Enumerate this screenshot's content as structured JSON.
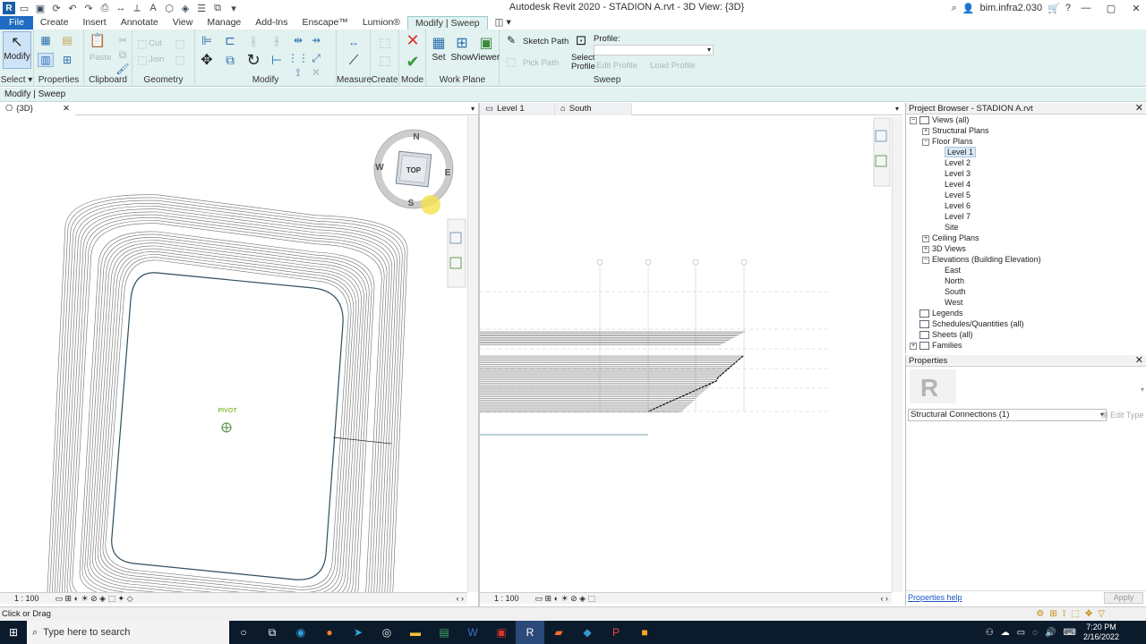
{
  "window": {
    "title": "Autodesk Revit 2020 - STADION A.rvt - 3D View: {3D}",
    "user": "bim.infra2.030"
  },
  "ribbon_tabs": [
    {
      "label": "File"
    },
    {
      "label": "Create"
    },
    {
      "label": "Insert"
    },
    {
      "label": "Annotate"
    },
    {
      "label": "View"
    },
    {
      "label": "Manage"
    },
    {
      "label": "Add-Ins"
    },
    {
      "label": "Enscape™"
    },
    {
      "label": "Lumion®"
    },
    {
      "label": "Modify | Sweep"
    }
  ],
  "ribbon": {
    "modify": "Modify",
    "select": "Select ▾",
    "properties": "Properties",
    "clipboard": "Clipboard",
    "paste": "Paste",
    "cut": "Cut",
    "join": "Join",
    "geometry": "Geometry",
    "modify_panel": "Modify",
    "measure": "Measure",
    "create": "Create",
    "mode": "Mode",
    "set": "Set",
    "show": "Show",
    "viewer": "Viewer",
    "work_plane": "Work Plane",
    "sketch_path": "Sketch Path",
    "pick_path": "Pick Path",
    "select_profile_line1": "Select",
    "select_profile_line2": "Profile",
    "profile_label": "Profile:",
    "edit_profile": "Edit Profile",
    "load_profile": "Load Profile",
    "sweep": "Sweep"
  },
  "context_bar": "Modify | Sweep",
  "view_tabs_left": [
    {
      "label": "{3D}"
    }
  ],
  "view_tabs_right": [
    {
      "label": "Level 1"
    },
    {
      "label": "South"
    }
  ],
  "view3d": {
    "pivot_label": "PIVOT",
    "viewcube_top": "TOP",
    "compass": {
      "n": "N",
      "s": "S",
      "e": "E",
      "w": "W"
    },
    "scale": "1 : 100"
  },
  "view_right": {
    "scale": "1 : 100"
  },
  "project_browser": {
    "title": "Project Browser - STADION A.rvt",
    "items": [
      {
        "label": "Views (all)",
        "indent": 0,
        "toggle": "−",
        "icon": true
      },
      {
        "label": "Structural Plans",
        "indent": 1,
        "toggle": "+"
      },
      {
        "label": "Floor Plans",
        "indent": 1,
        "toggle": "−"
      },
      {
        "label": "Level 1",
        "indent": 2,
        "selected": true
      },
      {
        "label": "Level 2",
        "indent": 2
      },
      {
        "label": "Level 3",
        "indent": 2
      },
      {
        "label": "Level 4",
        "indent": 2
      },
      {
        "label": "Level 5",
        "indent": 2
      },
      {
        "label": "Level 6",
        "indent": 2
      },
      {
        "label": "Level 7",
        "indent": 2
      },
      {
        "label": "Site",
        "indent": 2
      },
      {
        "label": "Ceiling Plans",
        "indent": 1,
        "toggle": "+"
      },
      {
        "label": "3D Views",
        "indent": 1,
        "toggle": "+"
      },
      {
        "label": "Elevations (Building Elevation)",
        "indent": 1,
        "toggle": "−"
      },
      {
        "label": "East",
        "indent": 2
      },
      {
        "label": "North",
        "indent": 2
      },
      {
        "label": "South",
        "indent": 2
      },
      {
        "label": "West",
        "indent": 2
      },
      {
        "label": "Legends",
        "indent": 0,
        "icon": true
      },
      {
        "label": "Schedules/Quantities (all)",
        "indent": 0,
        "icon": true
      },
      {
        "label": "Sheets (all)",
        "indent": 0,
        "icon": true
      },
      {
        "label": "Families",
        "indent": 0,
        "toggle": "+",
        "icon": true
      }
    ]
  },
  "properties": {
    "title": "Properties",
    "selector": "Structural Connections (1)",
    "edit_type": "Edit Type",
    "help_link": "Properties help",
    "apply": "Apply"
  },
  "status": "Click or Drag",
  "taskbar": {
    "search_placeholder": "Type here to search",
    "time": "7:20 PM",
    "date": "2/16/2022"
  },
  "colors": {
    "ribbon_bg": "#e1f2f0",
    "file_tab": "#1f6cc4",
    "taskbar": "#0c1b2c",
    "pivot": "#8fbf4a",
    "cancel": "#d9322b",
    "finish": "#3b9a3b"
  }
}
